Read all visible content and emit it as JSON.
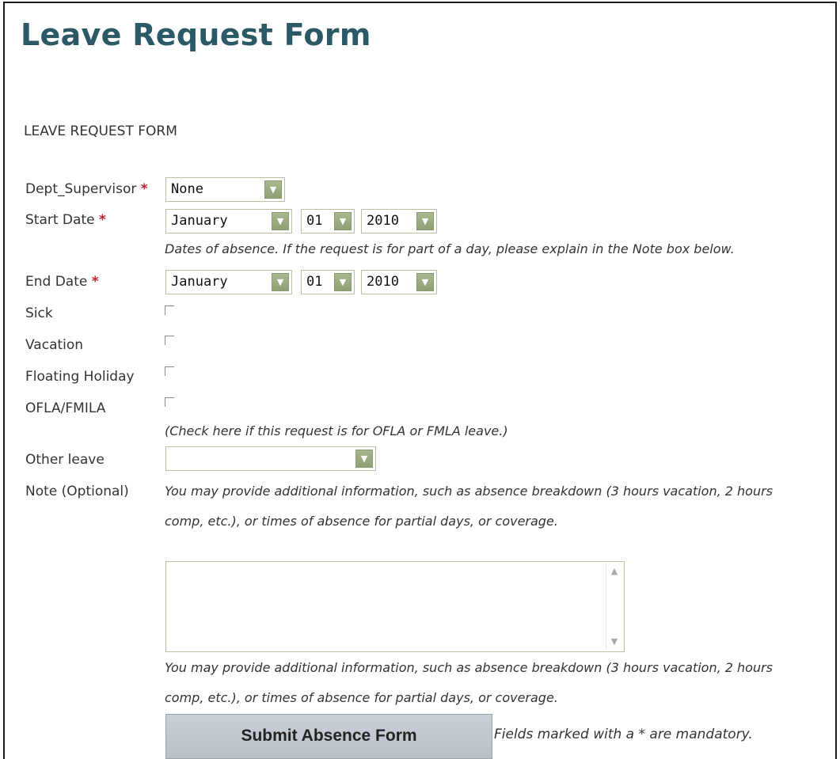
{
  "page": {
    "title": "Leave Request Form",
    "section_heading": "LEAVE REQUEST FORM",
    "required_marker": "*"
  },
  "fields": {
    "dept_supervisor": {
      "label": "Dept_Supervisor",
      "value": "None"
    },
    "start_date": {
      "label": "Start Date",
      "month": "January",
      "day": "01",
      "year": "2010"
    },
    "dates_hint": "Dates of absence. If the request is for part of a day, please explain in the Note box below.",
    "end_date": {
      "label": "End Date",
      "month": "January",
      "day": "01",
      "year": "2010"
    },
    "sick": {
      "label": "Sick",
      "checked": false
    },
    "vacation": {
      "label": "Vacation",
      "checked": false
    },
    "floating_holiday": {
      "label": "Floating Holiday",
      "checked": false
    },
    "ofla_fmla": {
      "label": "OFLA/FMILA",
      "checked": false,
      "hint": "(Check here if this request is for OFLA or FMLA leave.)"
    },
    "other_leave": {
      "label": "Other leave",
      "value": ""
    },
    "note": {
      "label": "Note (Optional)",
      "hint_line1": "You may provide additional information, such as absence breakdown (3 hours vacation, 2 hours",
      "hint_line2": "comp, etc.), or times of absence for partial days, or coverage.",
      "value": ""
    },
    "note_footer": {
      "line1": "You may provide additional information, such as absence breakdown (3 hours vacation, 2 hours",
      "line2": "comp, etc.), or times of absence for partial days, or coverage."
    }
  },
  "actions": {
    "submit_label": "Submit Absence Form",
    "mandatory_note": "Fields marked with a * are mandatory."
  },
  "icons": {
    "dropdown": "chevron-down-icon",
    "scroll_up": "scroll-up-icon",
    "scroll_down": "scroll-down-icon"
  },
  "colors": {
    "title": "#2b5a66",
    "required": "#c0202a",
    "dropdown_button": "#9bab80",
    "submit_bg": "#c4cbd1"
  }
}
